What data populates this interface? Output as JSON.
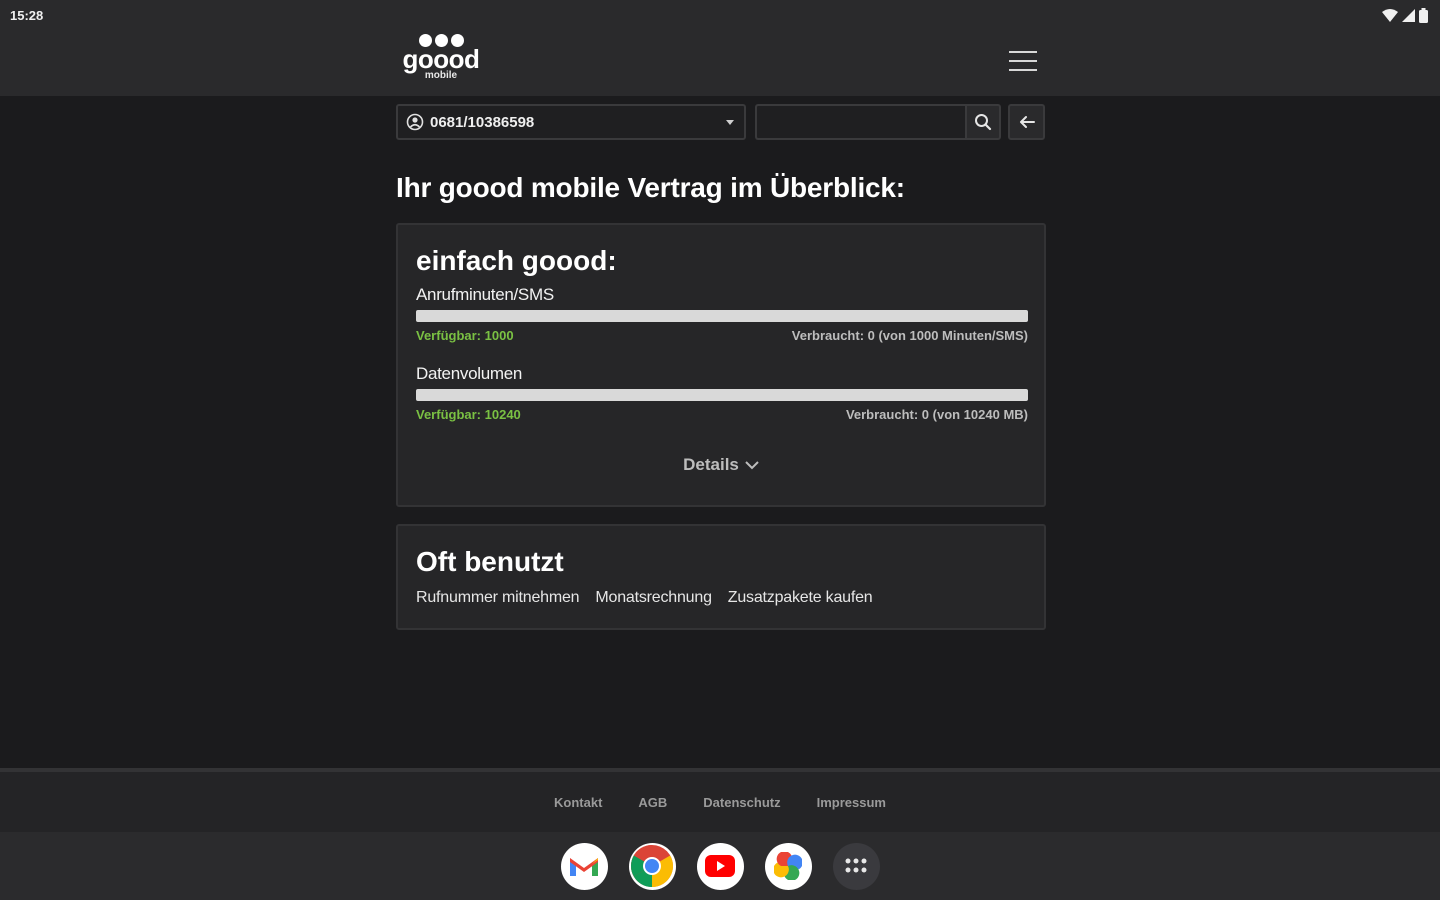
{
  "status_bar": {
    "time": "15:28"
  },
  "header": {
    "logo_word": "goood",
    "logo_sub": "mobile"
  },
  "controls": {
    "phone_number": "0681/10386598",
    "search_value": ""
  },
  "page_title": "Ihr goood mobile Vertrag im Überblick:",
  "plan_card": {
    "title": "einfach goood:",
    "usage": [
      {
        "label": "Anrufminuten/SMS",
        "available": "Verfügbar: 1000",
        "used": "Verbraucht: 0 (von 1000 Minuten/SMS)",
        "used_fraction": 0
      },
      {
        "label": "Datenvolumen",
        "available": "Verfügbar: 10240",
        "used": "Verbraucht: 0 (von 10240 MB)",
        "used_fraction": 0
      }
    ],
    "details_label": "Details"
  },
  "frequent_card": {
    "title": "Oft benutzt",
    "links": [
      "Rufnummer mitnehmen",
      "Monatsrechnung",
      "Zusatzpakete kaufen"
    ]
  },
  "footer": {
    "links": [
      "Kontakt",
      "AGB",
      "Datenschutz",
      "Impressum"
    ]
  },
  "dock": {
    "apps": [
      "gmail-icon",
      "chrome-icon",
      "youtube-icon",
      "photos-icon",
      "app-drawer-icon"
    ]
  },
  "colors": {
    "accent_green": "#7ac143",
    "background": "#1b1b1d",
    "card": "#262628"
  }
}
